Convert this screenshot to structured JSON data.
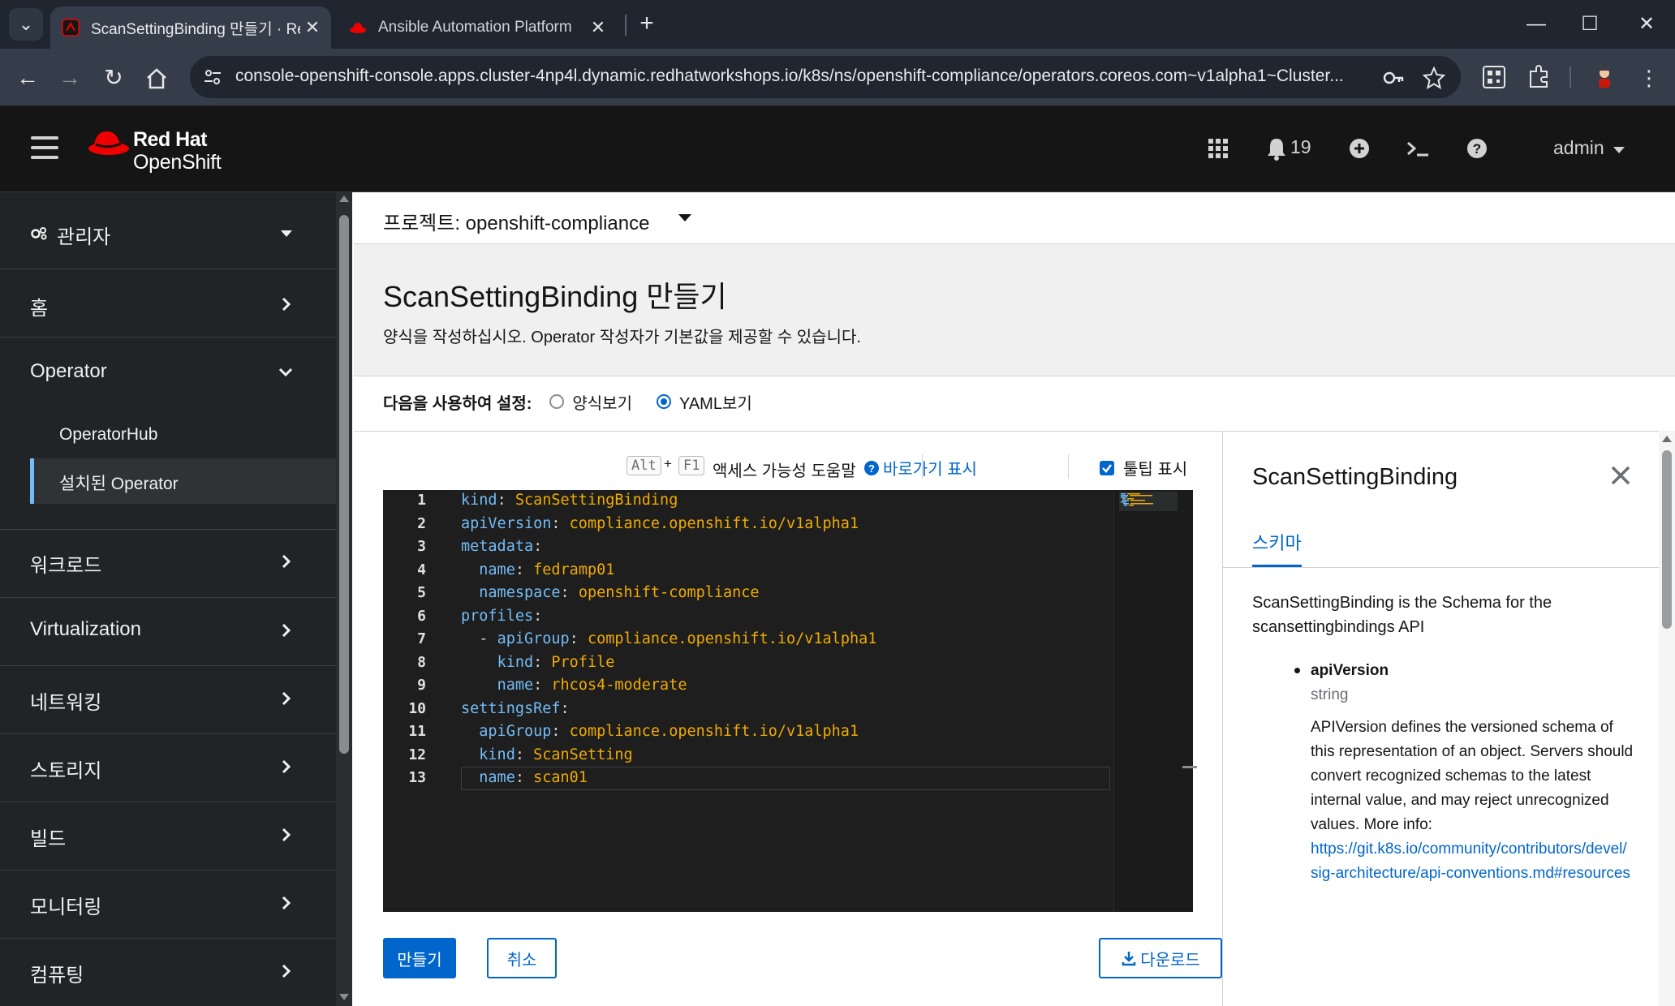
{
  "browser": {
    "tabs": [
      {
        "title": "ScanSettingBinding 만들기 · Re",
        "active": true
      },
      {
        "title": "Ansible Automation Platform",
        "active": false
      }
    ],
    "url": "console-openshift-console.apps.cluster-4np4l.dynamic.redhatworkshops.io/k8s/ns/openshift-compliance/operators.coreos.com~v1alpha1~Cluster..."
  },
  "masthead": {
    "logo_line1": "Red Hat",
    "logo_line2": "OpenShift",
    "notification_count": "19",
    "user": "admin"
  },
  "sidebar": {
    "perspective": "관리자",
    "items": [
      {
        "label": "홈"
      },
      {
        "label": "Operator"
      },
      {
        "label": "워크로드"
      },
      {
        "label": "Virtualization"
      },
      {
        "label": "네트워킹"
      },
      {
        "label": "스토리지"
      },
      {
        "label": "빌드"
      },
      {
        "label": "모니터링"
      },
      {
        "label": "컴퓨팅"
      }
    ],
    "operator_sub": [
      {
        "label": "OperatorHub"
      },
      {
        "label": "설치된 Operator"
      }
    ]
  },
  "main": {
    "project_label": "프로젝트: openshift-compliance",
    "title": "ScanSettingBinding 만들기",
    "description": "양식을 작성하십시오. Operator 작성자가 기본값을 제공할 수 있습니다.",
    "configure_label": "다음을 사용하여 설정:",
    "form_view": "양식보기",
    "yaml_view": "YAML보기",
    "kbd_alt": "Alt",
    "kbd_plus": "+",
    "kbd_f1": "F1",
    "a11y_help": "액세스 가능성 도움말",
    "shortcuts": "바로가기 표시",
    "tooltips": "툴팁 표시",
    "create": "만들기",
    "cancel": "취소",
    "download": "다운로드"
  },
  "editor": {
    "lines": [
      {
        "n": "1"
      },
      {
        "n": "2"
      },
      {
        "n": "3"
      },
      {
        "n": "4"
      },
      {
        "n": "5"
      },
      {
        "n": "6"
      },
      {
        "n": "7"
      },
      {
        "n": "8"
      },
      {
        "n": "9"
      },
      {
        "n": "10"
      },
      {
        "n": "11"
      },
      {
        "n": "12"
      },
      {
        "n": "13"
      }
    ],
    "code": {
      "l1k": "kind",
      "l1v": "ScanSettingBinding",
      "l2k": "apiVersion",
      "l2v": "compliance.openshift.io/v1alpha1",
      "l3k": "metadata",
      "l4k": "name",
      "l4v": "fedramp01",
      "l5k": "namespace",
      "l5v": "openshift-compliance",
      "l6k": "profiles",
      "l7k": "apiGroup",
      "l7v": "compliance.openshift.io/v1alpha1",
      "l8k": "kind",
      "l8v": "Profile",
      "l9k": "name",
      "l9v": "rhcos4-moderate",
      "l10k": "settingsRef",
      "l11k": "apiGroup",
      "l11v": "compliance.openshift.io/v1alpha1",
      "l12k": "kind",
      "l12v": "ScanSetting",
      "l13k": "name",
      "l13v": "scan01"
    }
  },
  "schema": {
    "title": "ScanSettingBinding",
    "tab": "스키마",
    "summary": "ScanSettingBinding is the Schema for the scansettingbindings API",
    "field_name": "apiVersion",
    "field_type": "string",
    "field_desc": "APIVersion defines the versioned schema of this representation of an object. Servers should convert recognized schemas to the latest internal value, and may reject unrecognized values. More info:",
    "field_link": "https://git.k8s.io/community/contributors/devel/sig-architecture/api-conventions.md#resources"
  },
  "colors": {
    "accent": "#0066cc",
    "yaml_key": "#73bcf7",
    "yaml_value": "#f0ab00",
    "redhat_red": "#ee0000"
  }
}
